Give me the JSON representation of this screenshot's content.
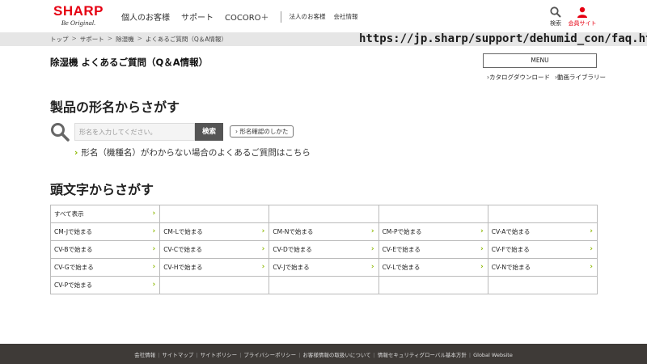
{
  "header": {
    "logo_main": "SHARP",
    "logo_sub": "Be Original.",
    "nav": [
      "個人のお客様",
      "サポート",
      "COCORO＋"
    ],
    "nav_small": [
      "法人のお客様",
      "会社情報"
    ],
    "search_label": "検索",
    "member_label": "会員サイト"
  },
  "breadcrumb": {
    "items": [
      "トップ",
      "サポート",
      "除湿機",
      "よくあるご質問（Q＆A情報）"
    ],
    "separator": ">",
    "url_overlay": "https://jp.sharp/support/dehumid_con/faq.html"
  },
  "page": {
    "title": "除湿機 よくあるご質問（Q＆A情報）",
    "menu_label": "MENU",
    "sub_links": [
      "›カタログダウンロード",
      "›動画ライブラリー"
    ]
  },
  "model_search": {
    "title": "製品の形名からさがす",
    "placeholder": "形名を入力してください。",
    "search_button": "検索",
    "howto_button": "› 形名確認のしかた",
    "faq_link_chevron": "›",
    "faq_link": "形名（機種名）がわからない場合のよくあるご質問はこちら"
  },
  "initials": {
    "title": "頭文字からさがす",
    "chevron": "›",
    "rows": [
      [
        "すべて表示",
        "",
        "",
        "",
        ""
      ],
      [
        "CM-Jで始まる",
        "CM-Lで始まる",
        "CM-Nで始まる",
        "CM-Pで始まる",
        "CV-Aで始まる"
      ],
      [
        "CV-Bで始まる",
        "CV-Cで始まる",
        "CV-Dで始まる",
        "CV-Eで始まる",
        "CV-Fで始まる"
      ],
      [
        "CV-Gで始まる",
        "CV-Hで始まる",
        "CV-Jで始まる",
        "CV-Lで始まる",
        "CV-Nで始まる"
      ],
      [
        "CV-Pで始まる",
        "",
        "",
        "",
        ""
      ]
    ]
  },
  "footer": {
    "links": [
      "会社情報",
      "サイトマップ",
      "サイトポリシー",
      "プライバシーポリシー",
      "お客様情報の取扱いについて",
      "情報セキュリティグローバル基本方針",
      "Global Website"
    ],
    "separator": "|"
  },
  "colors": {
    "brand_red": "#e60012",
    "chevron_green": "#8cb800",
    "footer_bg": "#3e3a37",
    "crumb_bg": "#e6e6e6"
  }
}
